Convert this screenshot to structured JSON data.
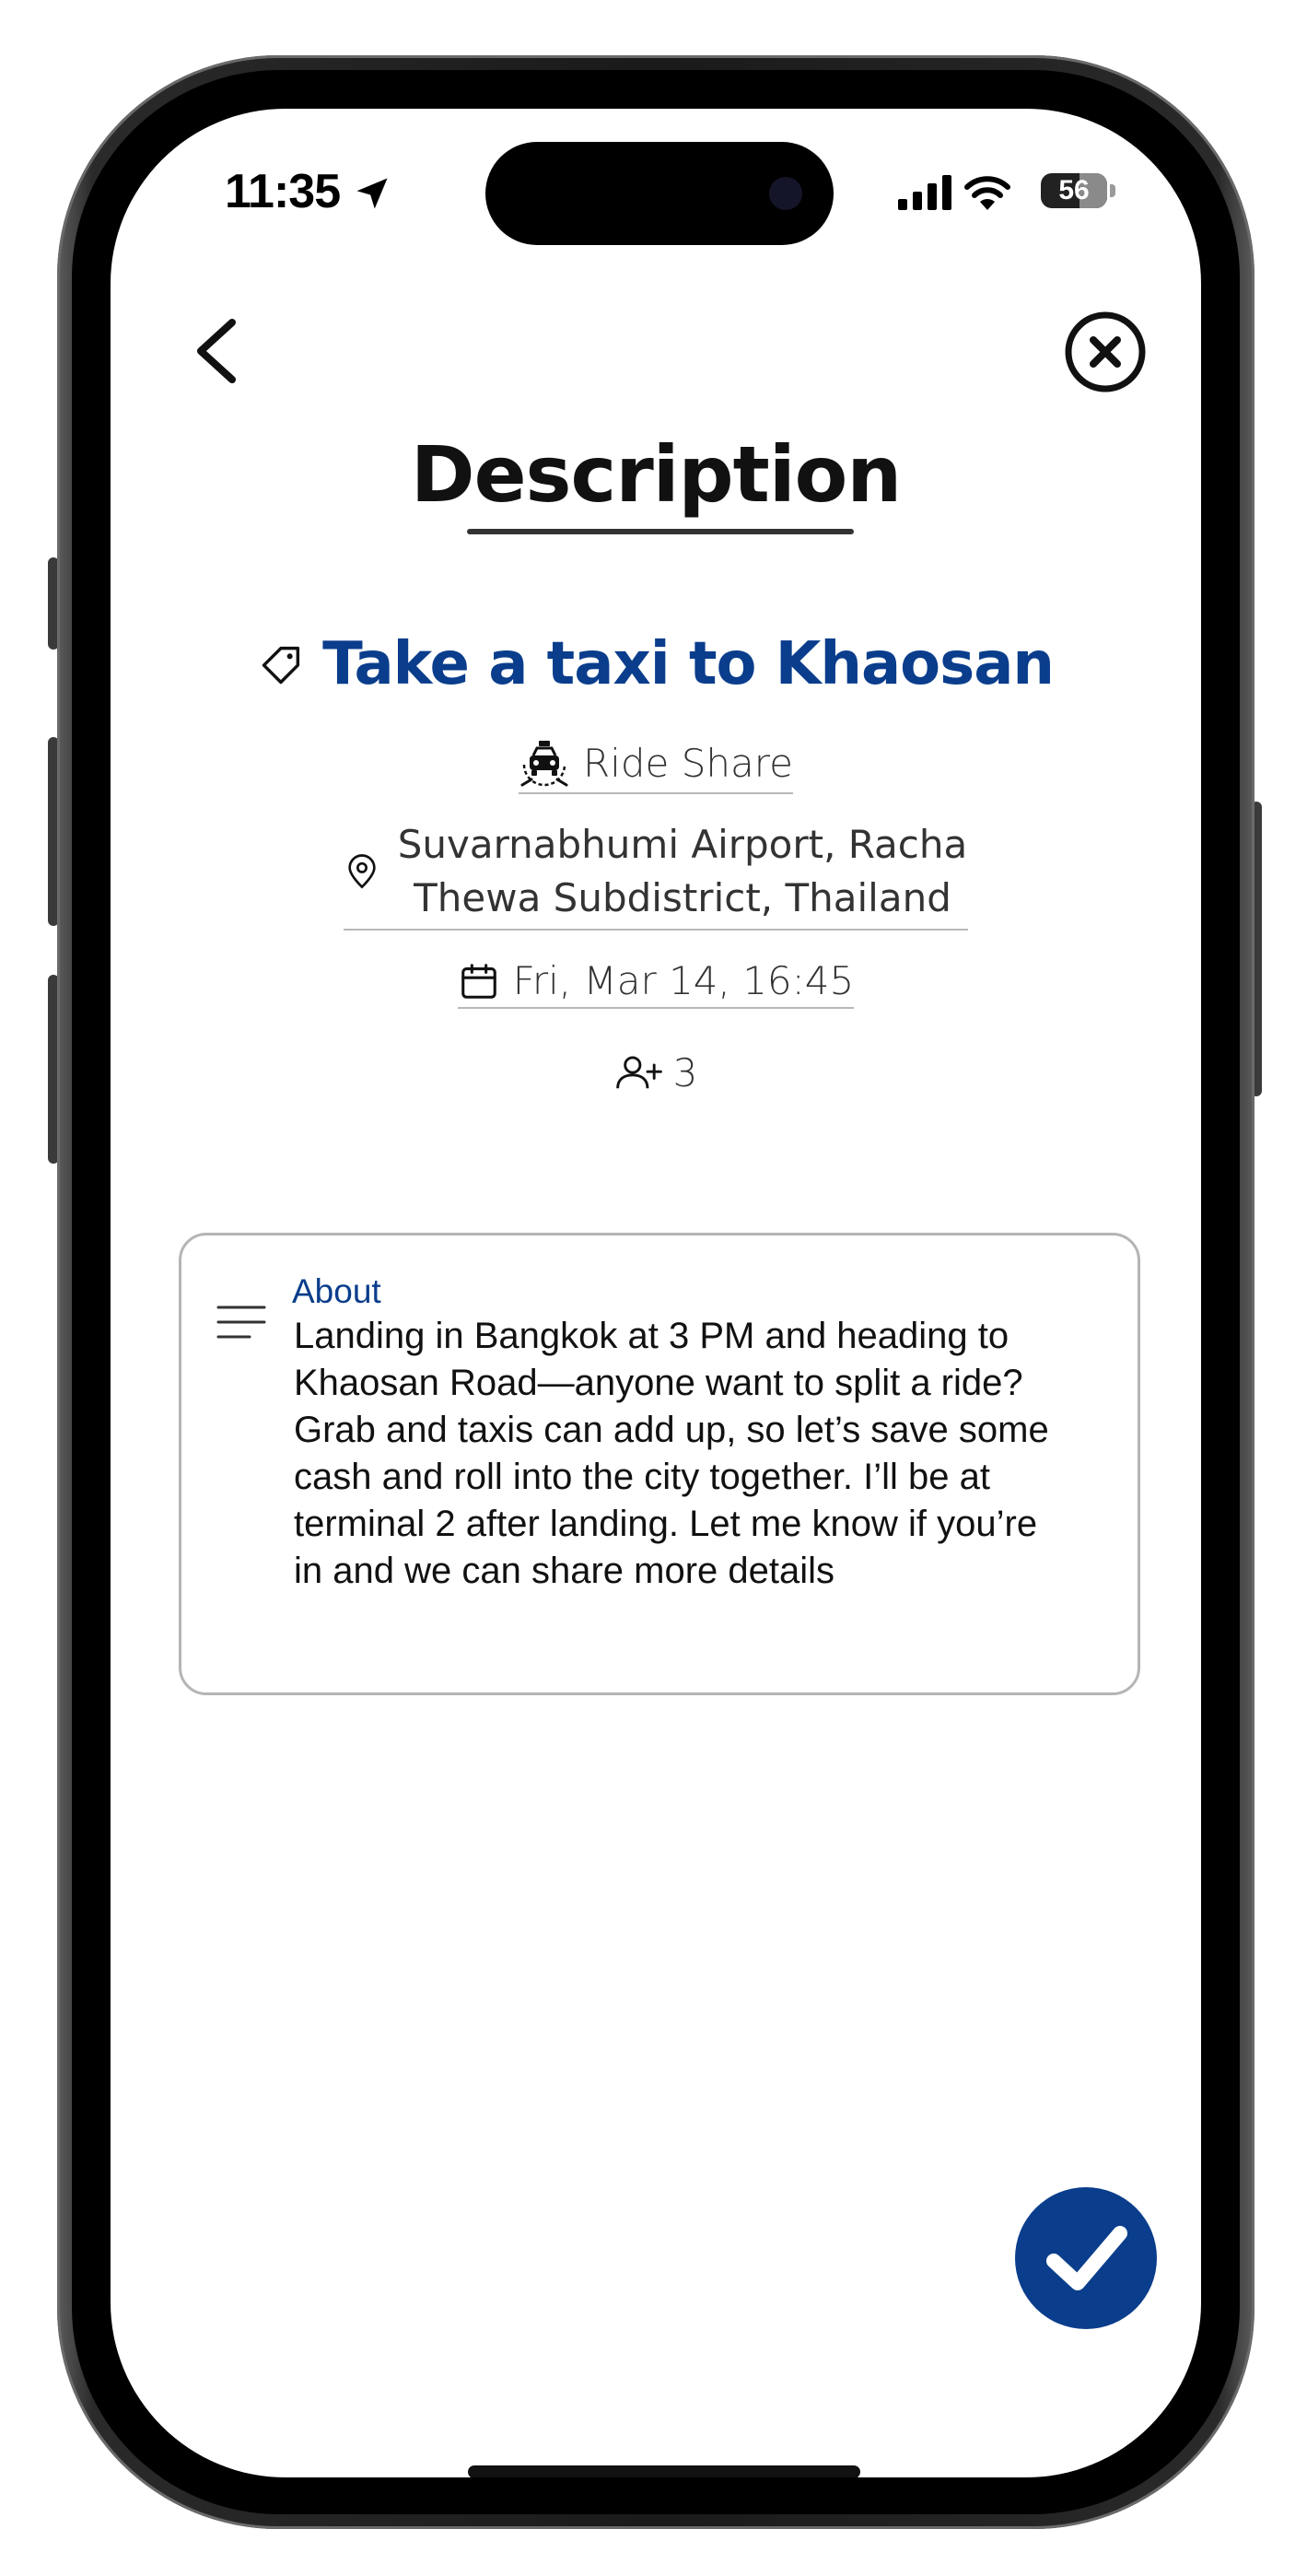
{
  "status_bar": {
    "time": "11:35",
    "battery": "56"
  },
  "header": {
    "title": "Description"
  },
  "event": {
    "title": "Take a taxi to Khaosan",
    "category": "Ride Share",
    "location": "Suvarnabhumi Airport, Racha Thewa Subdistrict, Thailand",
    "datetime": "Fri, Mar 14, 16:45",
    "participants": "3"
  },
  "about": {
    "label": "About",
    "text": "Landing in Bangkok at 3 PM and heading to Khaosan Road—anyone want to split a ride? Grab and taxis can add up, so let’s save some cash and roll into the city together. I’ll be at terminal 2 after landing. Let me know if you’re in and we can share more details"
  },
  "icons": {
    "back": "chevron-left-icon",
    "close": "close-circle-icon",
    "tag": "tag-icon",
    "category": "taxi-icon",
    "location": "map-pin-icon",
    "date": "calendar-icon",
    "participants": "user-plus-icon",
    "about": "text-lines-icon",
    "confirm": "checkmark-icon"
  },
  "colors": {
    "accent": "#0a3d8c",
    "text": "#111111",
    "border": "#b5b5b5"
  }
}
